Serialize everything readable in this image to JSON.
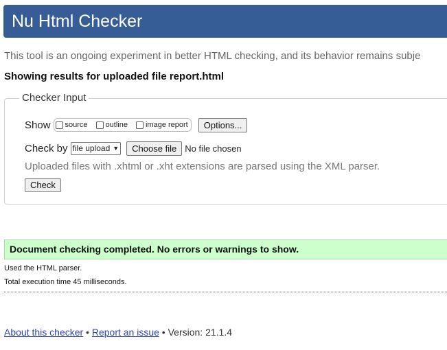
{
  "header": {
    "title": "Nu Html Checker"
  },
  "intro": "This tool is an ongoing experiment in better HTML checking, and its behavior remains subje",
  "showing": "Showing results for uploaded file report.html",
  "checker_input": {
    "legend": "Checker Input",
    "show_label": "Show",
    "show_options": [
      {
        "label": "source",
        "checked": false
      },
      {
        "label": "outline",
        "checked": false
      },
      {
        "label": "image report",
        "checked": false
      }
    ],
    "options_button": "Options...",
    "check_by_label": "Check by",
    "check_by_value": "file upload",
    "choose_file_button": "Choose file",
    "no_file_text": "No file chosen",
    "note": "Uploaded files with .xhtml or .xht extensions are parsed using the XML parser.",
    "check_button": "Check"
  },
  "result": {
    "success": "Document checking completed. No errors or warnings to show.",
    "parser": "Used the HTML parser.",
    "execution": "Total execution time 45 milliseconds."
  },
  "footer": {
    "about": "About this checker",
    "sep1": " • ",
    "report": "Report an issue",
    "version": " • Version: 21.1.4"
  },
  "colors": {
    "header_bg": "#365d95",
    "success_bg": "#ccffcc",
    "link": "#2a44b8"
  }
}
